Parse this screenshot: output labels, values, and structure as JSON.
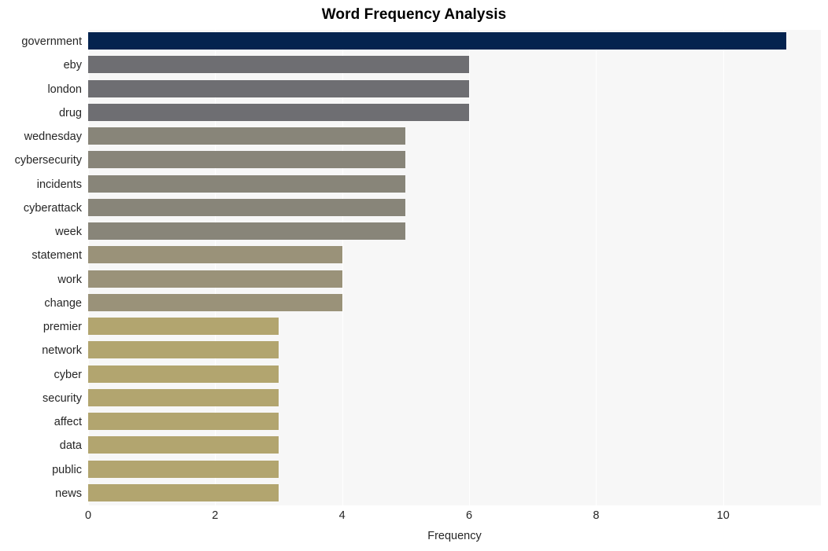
{
  "chart_data": {
    "type": "bar",
    "orientation": "horizontal",
    "title": "Word Frequency Analysis",
    "xlabel": "Frequency",
    "ylabel": "",
    "xlim": [
      0,
      11.54
    ],
    "xticks": [
      "0",
      "2",
      "4",
      "6",
      "8",
      "10"
    ],
    "xtick_values": [
      0,
      2,
      4,
      6,
      8,
      10
    ],
    "grid": "vertical-white-on-light-gray",
    "legend": "none",
    "categories": [
      "government",
      "eby",
      "london",
      "drug",
      "wednesday",
      "cybersecurity",
      "incidents",
      "cyberattack",
      "week",
      "statement",
      "work",
      "change",
      "premier",
      "network",
      "cyber",
      "security",
      "affect",
      "data",
      "public",
      "news"
    ],
    "values": [
      11,
      6,
      6,
      6,
      5,
      5,
      5,
      5,
      5,
      4,
      4,
      4,
      3,
      3,
      3,
      3,
      3,
      3,
      3,
      3
    ],
    "bar_colors": [
      "#04234f",
      "#6e6e72",
      "#6e6e72",
      "#6e6e72",
      "#888579",
      "#888579",
      "#888579",
      "#888579",
      "#888579",
      "#9a9279",
      "#9a9279",
      "#9a9279",
      "#b2a56f",
      "#b2a56f",
      "#b2a56f",
      "#b2a56f",
      "#b2a56f",
      "#b2a56f",
      "#b2a56f",
      "#b2a56f"
    ],
    "colors": {
      "plot_background": "#f7f7f7",
      "figure_background": "#ffffff",
      "gridline": "#ffffff",
      "text": "#262626",
      "title": "#000000"
    }
  }
}
